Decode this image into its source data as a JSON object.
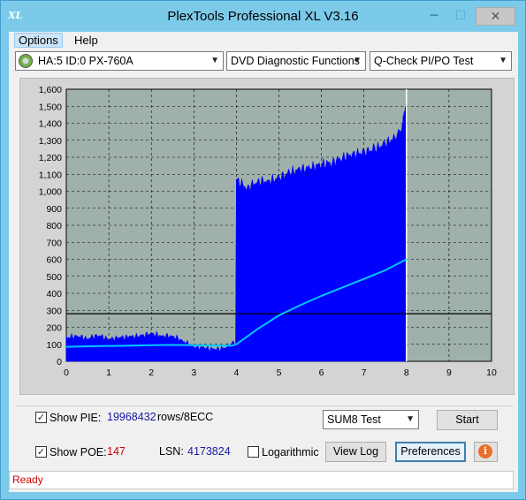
{
  "window": {
    "title": "PlexTools Professional XL V3.16",
    "app_icon": "XL",
    "minimize_glyph": "─",
    "maximize_glyph": "☐",
    "close_glyph": "✕"
  },
  "menu": {
    "options": "Options",
    "help": "Help"
  },
  "toolbar": {
    "drive": "HA:5 ID:0  PX-760A",
    "function": "DVD Diagnostic Functions",
    "test": "Q-Check PI/PO Test"
  },
  "chart_data": {
    "type": "area",
    "x_range": [
      0,
      10
    ],
    "y_range": [
      0,
      1600
    ],
    "x_ticks": [
      "0",
      "1",
      "2",
      "3",
      "4",
      "5",
      "6",
      "7",
      "8",
      "9",
      "10"
    ],
    "y_ticks": [
      "0",
      "100",
      "200",
      "300",
      "400",
      "500",
      "600",
      "700",
      "800",
      "900",
      "1,000",
      "1,100",
      "1,200",
      "1,300",
      "1,400",
      "1,500",
      "1,600"
    ],
    "threshold": 280,
    "grid": true,
    "colors": {
      "plot_bg": "#9fb1aa",
      "bars": "#0000ff",
      "curve": "#00c8ff",
      "threshold": "#000000"
    },
    "series": [
      {
        "kind": "bars",
        "points": [
          [
            0,
            140
          ],
          [
            0.25,
            150
          ],
          [
            0.5,
            135
          ],
          [
            0.75,
            155
          ],
          [
            1.0,
            130
          ],
          [
            1.25,
            140
          ],
          [
            1.5,
            145
          ],
          [
            1.75,
            150
          ],
          [
            2.0,
            165
          ],
          [
            2.25,
            150
          ],
          [
            2.5,
            150
          ],
          [
            2.75,
            120
          ],
          [
            3.0,
            85
          ],
          [
            3.25,
            80
          ],
          [
            3.5,
            70
          ],
          [
            3.75,
            80
          ],
          [
            3.98,
            120
          ],
          [
            4.0,
            1070
          ],
          [
            4.25,
            1020
          ],
          [
            4.5,
            1060
          ],
          [
            4.75,
            1060
          ],
          [
            5.0,
            1080
          ],
          [
            5.25,
            1110
          ],
          [
            5.5,
            1130
          ],
          [
            5.75,
            1140
          ],
          [
            6.0,
            1160
          ],
          [
            6.25,
            1170
          ],
          [
            6.5,
            1200
          ],
          [
            6.75,
            1220
          ],
          [
            7.0,
            1230
          ],
          [
            7.25,
            1250
          ],
          [
            7.5,
            1280
          ],
          [
            7.75,
            1320
          ],
          [
            7.9,
            1380
          ],
          [
            8.0,
            1540
          ]
        ]
      },
      {
        "kind": "curve",
        "points": [
          [
            0,
            85
          ],
          [
            0.5,
            88
          ],
          [
            1,
            90
          ],
          [
            1.5,
            92
          ],
          [
            2,
            95
          ],
          [
            2.5,
            96
          ],
          [
            3,
            95
          ],
          [
            3.5,
            92
          ],
          [
            3.9,
            92
          ],
          [
            4,
            100
          ],
          [
            4.5,
            190
          ],
          [
            5,
            270
          ],
          [
            5.5,
            330
          ],
          [
            6,
            385
          ],
          [
            6.5,
            435
          ],
          [
            7,
            485
          ],
          [
            7.5,
            535
          ],
          [
            8,
            600
          ]
        ]
      }
    ]
  },
  "controls": {
    "show_pie_label": "Show PIE:",
    "pie_value": "19968432",
    "pie_unit": "rows/8ECC",
    "show_poe_label": "Show POE:",
    "poe_value": "147",
    "lsn_label": "LSN:",
    "lsn_value": "4173824",
    "logarithmic_label": "Logarithmic",
    "sum_select": "SUM8 Test",
    "start_button": "Start",
    "view_log_button": "View Log",
    "preferences_button": "Preferences",
    "info_glyph": "i"
  },
  "status": {
    "text": "Ready"
  }
}
